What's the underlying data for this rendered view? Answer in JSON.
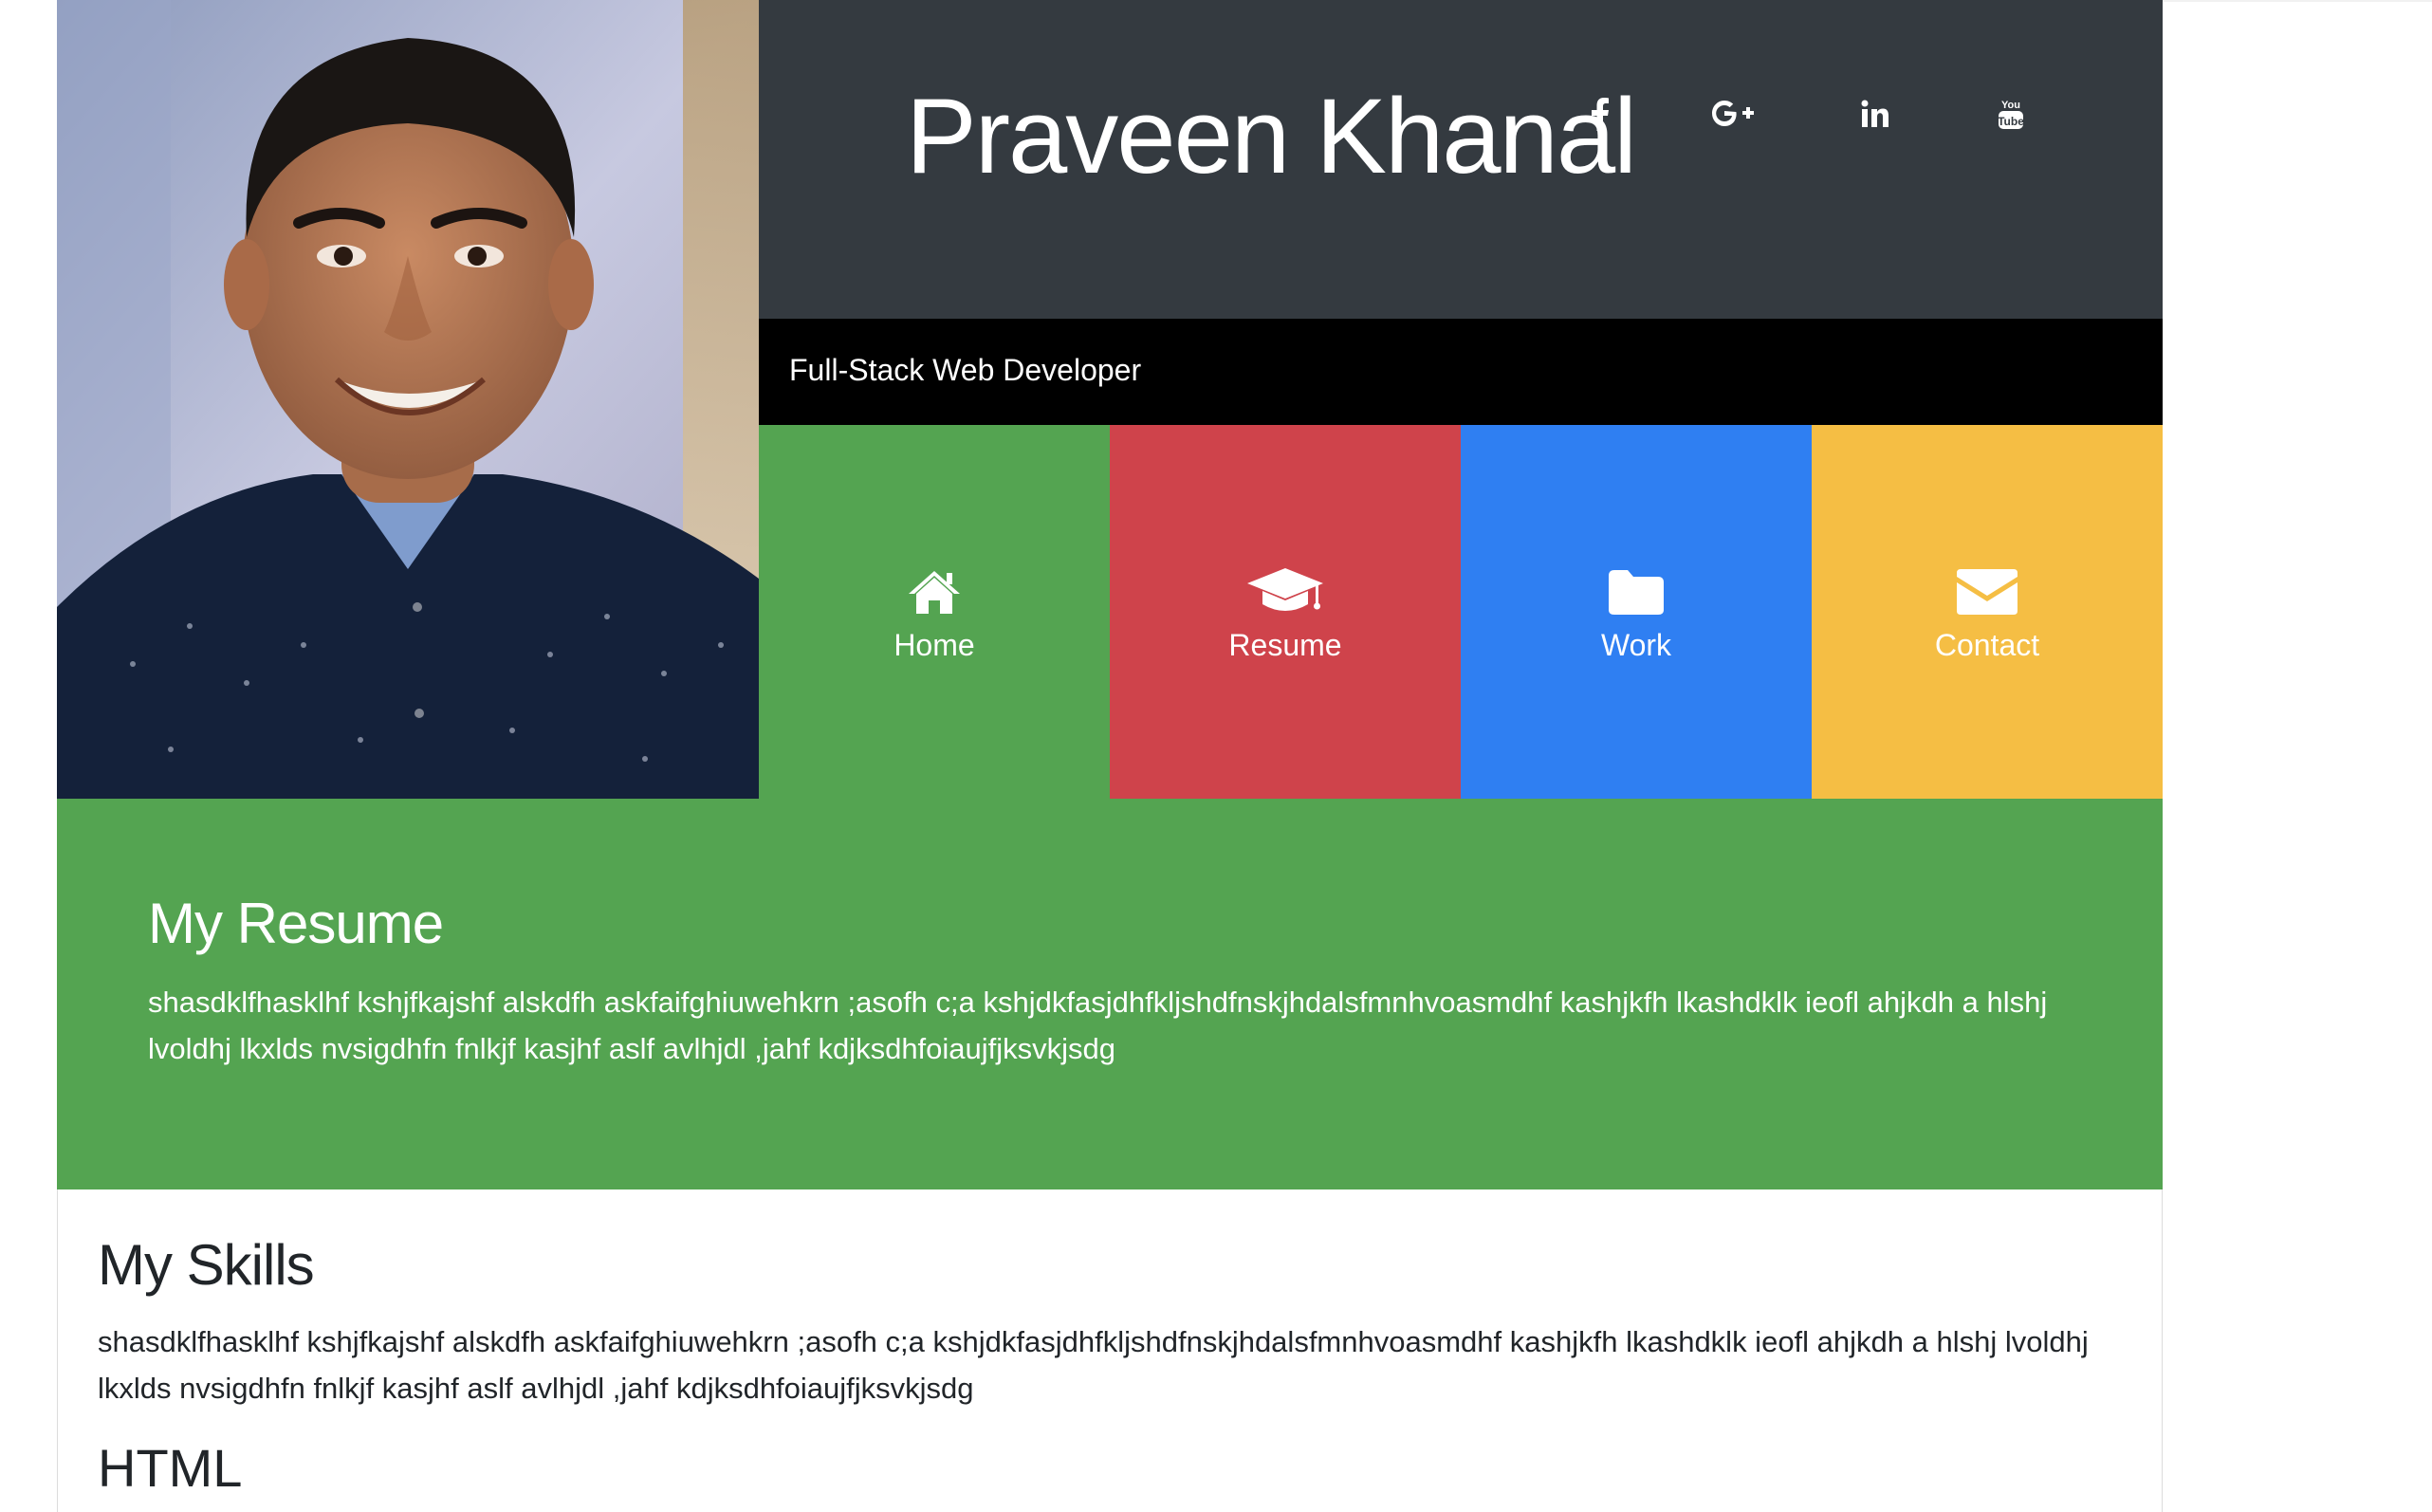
{
  "profile": {
    "name": "Praveen Khanal",
    "title": "Full-Stack Web Developer"
  },
  "social": [
    {
      "name": "facebook-link",
      "icon": "facebook-icon"
    },
    {
      "name": "google-plus-link",
      "icon": "google-plus-icon"
    },
    {
      "name": "linkedin-link",
      "icon": "linkedin-icon"
    },
    {
      "name": "youtube-link",
      "icon": "youtube-icon"
    }
  ],
  "nav": [
    {
      "label": "Home",
      "icon": "home-icon",
      "color": "#54a451"
    },
    {
      "label": "Resume",
      "icon": "graduation-cap-icon",
      "color": "#cf434b"
    },
    {
      "label": "Work",
      "icon": "folder-icon",
      "color": "#2f7ff2"
    },
    {
      "label": "Contact",
      "icon": "envelope-icon",
      "color": "#f5be44"
    }
  ],
  "resume": {
    "heading": "My Resume",
    "text": "shasdklfhasklhf kshjfkajshf alskdfh askfaifghiuwehkrn ;asofh c;a kshjdkfasjdhfkljshdfnskjhdalsfmnhvoasmdhf kashjkfh lkashdklk ieofl ahjkdh a hlshj lvoldhj lkxlds nvsigdhfn fnlkjf kasjhf aslf avlhjdl ,jahf kdjksdhfoiaujfjksvkjsdg"
  },
  "skills": {
    "heading": "My Skills",
    "text": "shasdklfhasklhf kshjfkajshf alskdfh askfaifghiuwehkrn ;asofh c;a kshjdkfasjdhfkljshdfnskjhdalsfmnhvoasmdhf kashjkfh lkashdklk ieofl ahjkdh a hlshj lvoldhj lkxlds nvsigdhfn fnlkjf kasjhf aslf avlhjdl ,jahf kdjksdhfoiaujfjksvkjsdg",
    "first_skill": "HTML"
  },
  "colors": {
    "header_dark": "#343a40",
    "subtitle_bar": "#000000",
    "resume_green": "#54a451"
  }
}
